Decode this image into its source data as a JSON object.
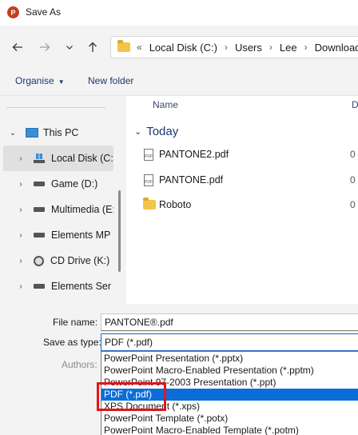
{
  "window": {
    "title": "Save As",
    "app_icon_letter": "P"
  },
  "address_bar": {
    "overflow": "«",
    "crumbs": [
      "Local Disk (C:)",
      "Users",
      "Lee",
      "Downloads"
    ],
    "separator": "›"
  },
  "toolbar": {
    "organise_label": "Organise",
    "new_folder_label": "New folder"
  },
  "sidebar": {
    "items": [
      {
        "label": "This PC",
        "icon": "pc-icon"
      },
      {
        "label": "Local Disk (C:)",
        "icon": "windows-drive-icon"
      },
      {
        "label": "Game (D:)",
        "icon": "drive-icon"
      },
      {
        "label": "Multimedia (E:)",
        "icon": "drive-icon"
      },
      {
        "label": "Elements MP",
        "icon": "drive-icon"
      },
      {
        "label": "CD Drive (K:)",
        "icon": "cd-drive-icon"
      },
      {
        "label": "Elements Ser",
        "icon": "drive-icon"
      }
    ]
  },
  "file_list": {
    "columns": {
      "name": "Name",
      "date": "D"
    },
    "group_label": "Today",
    "files": [
      {
        "name": "PANTONE2.pdf",
        "type": "pdf",
        "date": "0"
      },
      {
        "name": "PANTONE.pdf",
        "type": "pdf",
        "date": "0"
      },
      {
        "name": "Roboto",
        "type": "folder",
        "date": "0"
      }
    ]
  },
  "form": {
    "file_name_label": "File name:",
    "file_name_value": "PANTONE®.pdf",
    "save_type_label": "Save as type:",
    "save_type_value": "PDF (*.pdf)",
    "authors_label": "Authors:",
    "options": [
      "PowerPoint Presentation (*.pptx)",
      "PowerPoint Macro-Enabled Presentation (*.pptm)",
      "PowerPoint 97-2003 Presentation (*.ppt)",
      "PDF (*.pdf)",
      "XPS Document (*.xps)",
      "PowerPoint Template (*.potx)",
      "PowerPoint Macro-Enabled Template (*.potm)"
    ],
    "selected_index": 3
  },
  "colors": {
    "accent": "#0a6dd8",
    "highlight_border": "#e3141b",
    "folder": "#f2c44a"
  }
}
